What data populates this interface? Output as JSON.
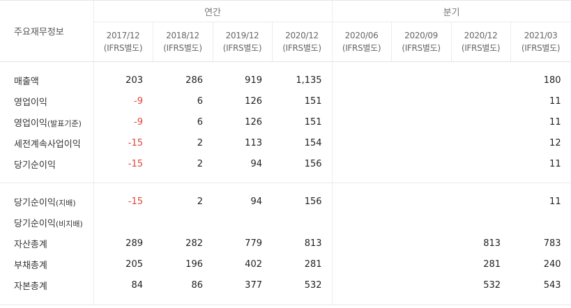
{
  "header": {
    "corner_label": "주요재무정보",
    "group_annual": "연간",
    "group_quarter": "분기",
    "annual_periods": [
      {
        "date": "2017/12",
        "basis": "(IFRS별도)"
      },
      {
        "date": "2018/12",
        "basis": "(IFRS별도)"
      },
      {
        "date": "2019/12",
        "basis": "(IFRS별도)"
      },
      {
        "date": "2020/12",
        "basis": "(IFRS별도)"
      }
    ],
    "quarter_periods": [
      {
        "date": "2020/06",
        "basis": "(IFRS별도)"
      },
      {
        "date": "2020/09",
        "basis": "(IFRS별도)"
      },
      {
        "date": "2020/12",
        "basis": "(IFRS별도)"
      },
      {
        "date": "2021/03",
        "basis": "(IFRS별도)"
      }
    ]
  },
  "rows": [
    {
      "label": "매출액",
      "label_suffix": "",
      "annual": [
        "203",
        "286",
        "919",
        "1,135"
      ],
      "quarter": [
        "",
        "",
        "",
        "180"
      ]
    },
    {
      "label": "영업이익",
      "label_suffix": "",
      "annual": [
        "-9",
        "6",
        "126",
        "151"
      ],
      "quarter": [
        "",
        "",
        "",
        "11"
      ]
    },
    {
      "label": "영업이익",
      "label_suffix": "(발표기준)",
      "annual": [
        "-9",
        "6",
        "126",
        "151"
      ],
      "quarter": [
        "",
        "",
        "",
        "11"
      ]
    },
    {
      "label": "세전계속사업이익",
      "label_suffix": "",
      "annual": [
        "-15",
        "2",
        "113",
        "154"
      ],
      "quarter": [
        "",
        "",
        "",
        "12"
      ]
    },
    {
      "label": "당기순이익",
      "label_suffix": "",
      "annual": [
        "-15",
        "2",
        "94",
        "156"
      ],
      "quarter": [
        "",
        "",
        "",
        "11"
      ]
    },
    {
      "label": "당기순이익",
      "label_suffix": "(지배)",
      "annual": [
        "-15",
        "2",
        "94",
        "156"
      ],
      "quarter": [
        "",
        "",
        "",
        "11"
      ]
    },
    {
      "label": "당기순이익",
      "label_suffix": "(비지배)",
      "annual": [
        "",
        "",
        "",
        ""
      ],
      "quarter": [
        "",
        "",
        "",
        ""
      ]
    },
    {
      "label": "자산총계",
      "label_suffix": "",
      "annual": [
        "289",
        "282",
        "779",
        "813"
      ],
      "quarter": [
        "",
        "",
        "813",
        "783"
      ]
    },
    {
      "label": "부채총계",
      "label_suffix": "",
      "annual": [
        "205",
        "196",
        "402",
        "281"
      ],
      "quarter": [
        "",
        "",
        "281",
        "240"
      ]
    },
    {
      "label": "자본총계",
      "label_suffix": "",
      "annual": [
        "84",
        "86",
        "377",
        "532"
      ],
      "quarter": [
        "",
        "",
        "532",
        "543"
      ]
    }
  ]
}
